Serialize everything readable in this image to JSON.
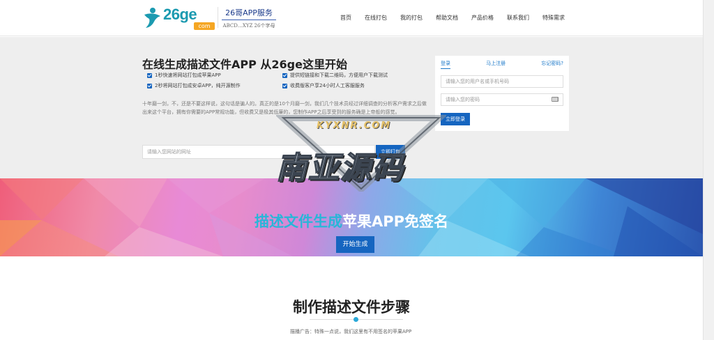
{
  "header": {
    "logo_text": "26ge",
    "logo_suffix": "com",
    "tagline_title": "26哥APP服务",
    "tagline_sub": "ABCD…XYZ 26个字母",
    "nav": [
      "首页",
      "在线打包",
      "我的打包",
      "帮助文档",
      "产品价格",
      "联系我们",
      "特殊需求"
    ]
  },
  "hero": {
    "title": "在线生成描述文件APP 从26ge这里开始",
    "features": [
      "1秒快速将网站打包成苹果APP",
      "提供短链接和下载二维码，方便用户下载测试",
      "2秒将网站打包成安卓APP，纯开源制作",
      "收费版客户享24小时人工客服服务"
    ],
    "description": "十年磨一剑，不，还是不要这样说，这句话是骗人的。真正的是10个月磨一剑，我们几个技术员经过详细调查的分析客户需求之后做出来这个平台，拥有你需要的APP常规功能，但收费又是极其低廉的，您制作APP之后享受到的服务确是上帝般的感觉。",
    "url_placeholder": "请输入您网站的网址",
    "pack_button": "立即打包"
  },
  "login": {
    "tabs": [
      "登录",
      "马上注册",
      "忘记密码?"
    ],
    "username_placeholder": "请输入您的用户名或手机号码",
    "password_placeholder": "请输入您的密码",
    "submit": "立即登录"
  },
  "watermark": {
    "small": "KYXNR.COM",
    "big": "南亚源码"
  },
  "banner": {
    "title_highlight": "描述文件生成",
    "title_rest": "苹果APP免签名",
    "button": "开始生成"
  },
  "steps": {
    "title": "制作描述文件步骤",
    "description": "描播广告：特殊一点说，我们这里有不用签名的苹果APP"
  },
  "colors": {
    "accent": "#1565c0",
    "brand": "#1b9ab0",
    "highlight": "#29b6d8"
  }
}
